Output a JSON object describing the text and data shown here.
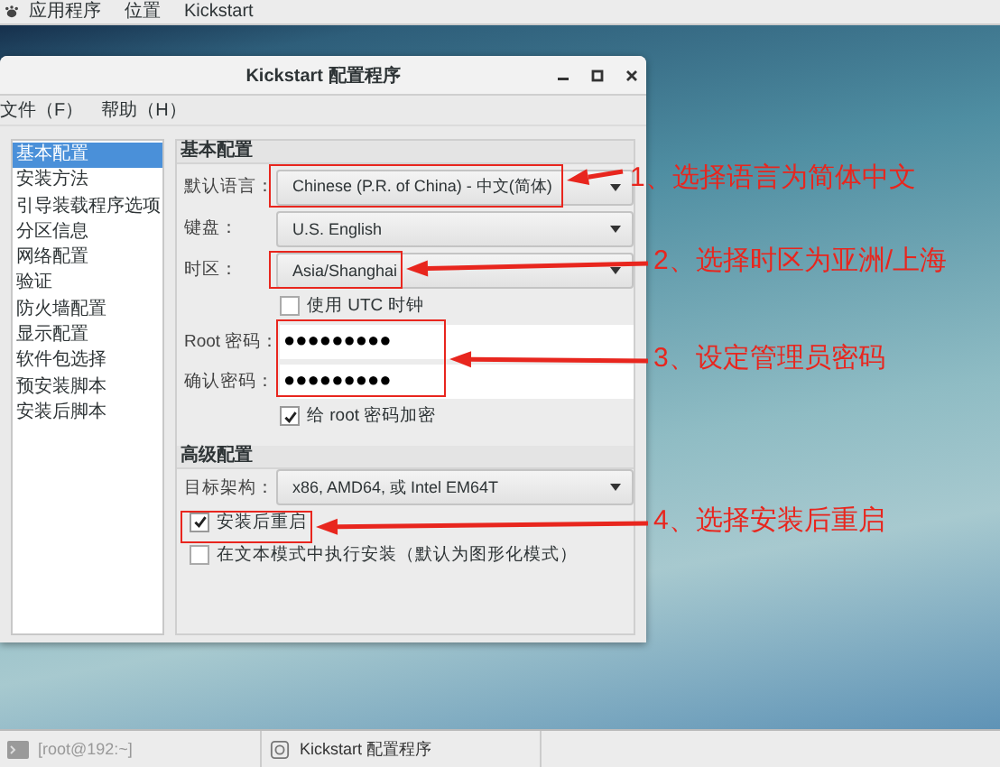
{
  "top_bar": {
    "menus": [
      "应用程序",
      "位置",
      "Kickstart"
    ]
  },
  "window": {
    "title": "Kickstart 配置程序",
    "menu": [
      "文件（F）",
      "帮助（H）"
    ]
  },
  "sidebar": {
    "items": [
      {
        "label": "基本配置",
        "selected": true
      },
      {
        "label": "安装方法",
        "selected": false
      },
      {
        "label": "引导装载程序选项",
        "selected": false
      },
      {
        "label": "分区信息",
        "selected": false
      },
      {
        "label": "网络配置",
        "selected": false
      },
      {
        "label": "验证",
        "selected": false
      },
      {
        "label": "防火墙配置",
        "selected": false
      },
      {
        "label": "显示配置",
        "selected": false
      },
      {
        "label": "软件包选择",
        "selected": false
      },
      {
        "label": "预安装脚本",
        "selected": false
      },
      {
        "label": "安装后脚本",
        "selected": false
      }
    ]
  },
  "basic": {
    "title": "基本配置",
    "rows": [
      {
        "kind": "combo",
        "label": "默认语言：",
        "value": "Chinese (P.R. of China) - 中文(简体)"
      },
      {
        "kind": "combo",
        "label": "键盘：",
        "value": "U.S. English"
      },
      {
        "kind": "combo",
        "label": "时区：",
        "value": "Asia/Shanghai"
      },
      {
        "kind": "checkbox",
        "label": "使用 UTC 时钟",
        "checked": false
      },
      {
        "kind": "password",
        "label": "Root 密码：",
        "value": "●●●●●●●●●"
      },
      {
        "kind": "password",
        "label": "确认密码：",
        "value": "●●●●●●●●●"
      },
      {
        "kind": "checkbox",
        "label": "给 root 密码加密",
        "checked": true
      }
    ]
  },
  "advanced": {
    "title": "高级配置",
    "rows": [
      {
        "kind": "combo",
        "label": "目标架构：",
        "value": "x86, AMD64, 或 Intel EM64T"
      },
      {
        "kind": "checkbox",
        "label": "安装后重启",
        "checked": true
      },
      {
        "kind": "checkbox",
        "label": "在文本模式中执行安装（默认为图形化模式）",
        "checked": false
      }
    ]
  },
  "annotations": [
    {
      "text": "1、选择语言为简体中文"
    },
    {
      "text": "2、选择时区为亚洲/上海"
    },
    {
      "text": "3、设定管理员密码"
    },
    {
      "text": "4、选择安装后重启"
    }
  ],
  "taskbar": {
    "items": [
      {
        "label": "[root@192:~]"
      },
      {
        "label": "Kickstart 配置程序"
      }
    ]
  }
}
